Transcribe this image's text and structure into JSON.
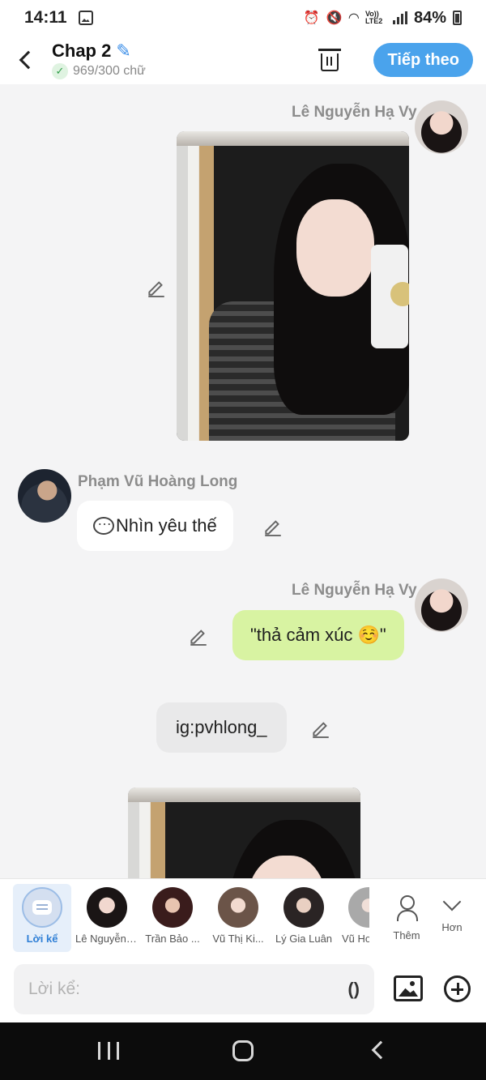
{
  "status_bar": {
    "time": "14:11",
    "lte_label": "Vo)) LTE2",
    "battery": "84%"
  },
  "header": {
    "title": "Chap 2",
    "word_count": "969/300 chữ",
    "next_label": "Tiếp theo"
  },
  "chat": {
    "sender_1": "Lê Nguyễn Hạ Vy",
    "sender_2": "Phạm Vũ Hoàng Long",
    "sender_3": "Lê Nguyễn Hạ Vy",
    "message_long": "Nhìn yêu thế",
    "message_vy": "\"thả cảm xúc ☺️\"",
    "narration": "ig:pvhlong_"
  },
  "characters": [
    {
      "label": "Lời kể"
    },
    {
      "label": "Lê Nguyễn Hạ Vy"
    },
    {
      "label": "Trần Bảo ..."
    },
    {
      "label": "Vũ Thị Ki..."
    },
    {
      "label": "Lý Gia Luân"
    },
    {
      "label": "Vũ Ho"
    },
    {
      "label": "Thêm"
    },
    {
      "label": "Hơn"
    }
  ],
  "input": {
    "placeholder": "Lời kể:",
    "paren_label": "()"
  }
}
